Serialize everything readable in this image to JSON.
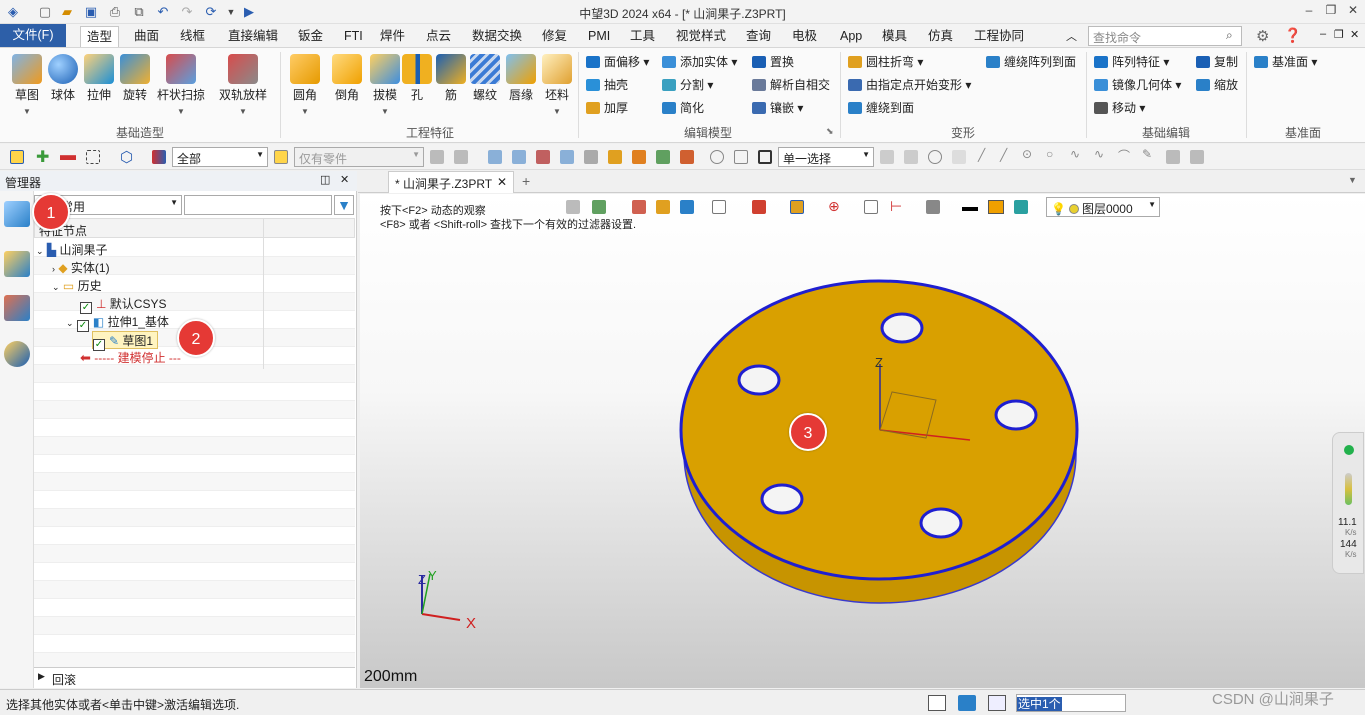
{
  "title_bar": {
    "title": "中望3D 2024 x64 - [* 山涧果子.Z3PRT]"
  },
  "menu": {
    "file": "文件(F)",
    "tabs": [
      "造型",
      "曲面",
      "线框",
      "直接编辑",
      "钣金",
      "FTI",
      "焊件",
      "点云",
      "数据交换",
      "修复",
      "PMI",
      "工具",
      "视觉样式",
      "查询",
      "电极",
      "App",
      "模具",
      "仿真",
      "工程协同"
    ],
    "active": "造型",
    "search_placeholder": "查找命令"
  },
  "ribbon": {
    "basic_shape": {
      "label": "基础造型",
      "buttons": [
        "草图",
        "球体",
        "拉伸",
        "旋转",
        "杆状扫掠",
        "双轨放样"
      ]
    },
    "engineering": {
      "label": "工程特征",
      "buttons": [
        "圆角",
        "倒角",
        "拔模",
        "孔",
        "筋",
        "螺纹",
        "唇缘",
        "坯料"
      ]
    },
    "edit_model": {
      "label": "编辑模型",
      "items": [
        "面偏移",
        "抽壳",
        "加厚",
        "添加实体",
        "分割",
        "简化",
        "置换",
        "解析自相交",
        "镶嵌"
      ]
    },
    "deform": {
      "label": "变形",
      "items": [
        "圆柱折弯",
        "由指定点开始变形",
        "缠绕到面",
        "缠绕阵列到面"
      ]
    },
    "basic_edit": {
      "label": "基础编辑",
      "items": [
        "阵列特征",
        "镜像几何体",
        "移动",
        "复制",
        "缩放"
      ]
    },
    "datum": {
      "label": "基准面",
      "items": [
        "基准面"
      ]
    }
  },
  "toolbar2": {
    "filter_all": "全部",
    "filter_part": "仅有零件",
    "select_mode": "单一选择"
  },
  "manager": {
    "title": "管理器",
    "filter": "常用",
    "tree_header": "特征节点",
    "nodes": [
      "山涧果子",
      "实体(1)",
      "历史",
      "默认CSYS",
      "拉伸1_基体",
      "草图1",
      "----- 建模停止 ---"
    ],
    "footer": "回滚"
  },
  "document": {
    "tab": "* 山涧果子.Z3PRT",
    "hint1": "按下<F2> 动态的观察",
    "hint2": "<F8> 或者 <Shift-roll> 查找下一个有效的过滤器设置.",
    "layer": "图层0000",
    "scale": "200mm",
    "axis_x": "X",
    "axis_y": "Y",
    "axis_z": "Z"
  },
  "badges": [
    "1",
    "2",
    "3"
  ],
  "monitor": {
    "v1": "11.1",
    "u1": "K/s",
    "v2": "144",
    "u2": "K/s"
  },
  "status": {
    "message": "选择其他实体或者<单击中键>激活编辑选项.",
    "selected": "选中1个",
    "watermark": "CSDN @山涧果子"
  }
}
